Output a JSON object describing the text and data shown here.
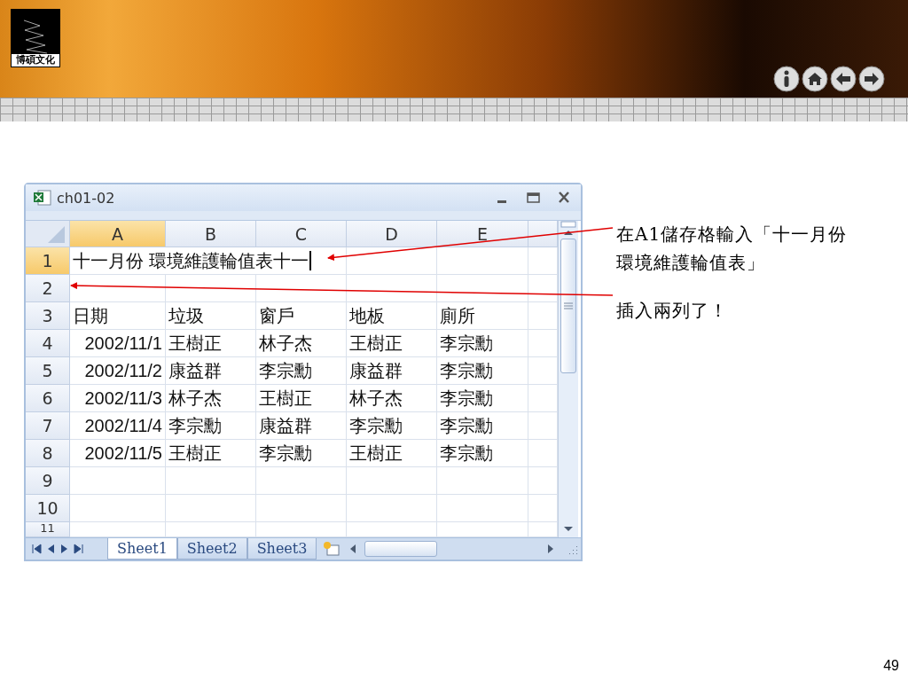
{
  "slide": {
    "logo_text": "博碩文化",
    "page_number": "49"
  },
  "window": {
    "title": "ch01-02"
  },
  "sheet": {
    "columns": [
      {
        "label": "A",
        "selected": true
      },
      {
        "label": "B",
        "selected": false
      },
      {
        "label": "C",
        "selected": false
      },
      {
        "label": "D",
        "selected": false
      },
      {
        "label": "E",
        "selected": false
      }
    ],
    "rows": [
      {
        "number": "1",
        "selected": true,
        "kind": "title",
        "cells": [
          "十一月份 環境維護輪值表十一",
          "",
          "",
          "",
          ""
        ]
      },
      {
        "number": "2",
        "selected": false,
        "kind": "blank",
        "cells": [
          "",
          "",
          "",
          "",
          ""
        ]
      },
      {
        "number": "3",
        "selected": false,
        "kind": "header",
        "cells": [
          "日期",
          "垃圾",
          "窗戶",
          "地板",
          "廁所"
        ]
      },
      {
        "number": "4",
        "selected": false,
        "kind": "data",
        "cells": [
          "2002/11/1",
          "王樹正",
          "林子杰",
          "王樹正",
          "李宗勳"
        ]
      },
      {
        "number": "5",
        "selected": false,
        "kind": "data",
        "cells": [
          "2002/11/2",
          "康益群",
          "李宗勳",
          "康益群",
          "李宗勳"
        ]
      },
      {
        "number": "6",
        "selected": false,
        "kind": "data",
        "cells": [
          "2002/11/3",
          "林子杰",
          "王樹正",
          "林子杰",
          "李宗勳"
        ]
      },
      {
        "number": "7",
        "selected": false,
        "kind": "data",
        "cells": [
          "2002/11/4",
          "李宗勳",
          "康益群",
          "李宗勳",
          "李宗勳"
        ]
      },
      {
        "number": "8",
        "selected": false,
        "kind": "data",
        "cells": [
          "2002/11/5",
          "王樹正",
          "李宗勳",
          "王樹正",
          "李宗勳"
        ]
      },
      {
        "number": "9",
        "selected": false,
        "kind": "blank",
        "cells": [
          "",
          "",
          "",
          "",
          ""
        ]
      },
      {
        "number": "10",
        "selected": false,
        "kind": "blank",
        "cells": [
          "",
          "",
          "",
          "",
          ""
        ]
      },
      {
        "number": "11",
        "selected": false,
        "kind": "partial",
        "cells": [
          "",
          "",
          "",
          "",
          ""
        ]
      }
    ]
  },
  "sheet_tabs": [
    {
      "label": "Sheet1",
      "selected": true
    },
    {
      "label": "Sheet2",
      "selected": false
    },
    {
      "label": "Sheet3",
      "selected": false
    }
  ],
  "callouts": [
    "在A1儲存格輸入「十一月份環境維護輪值表」",
    "插入兩列了！"
  ]
}
